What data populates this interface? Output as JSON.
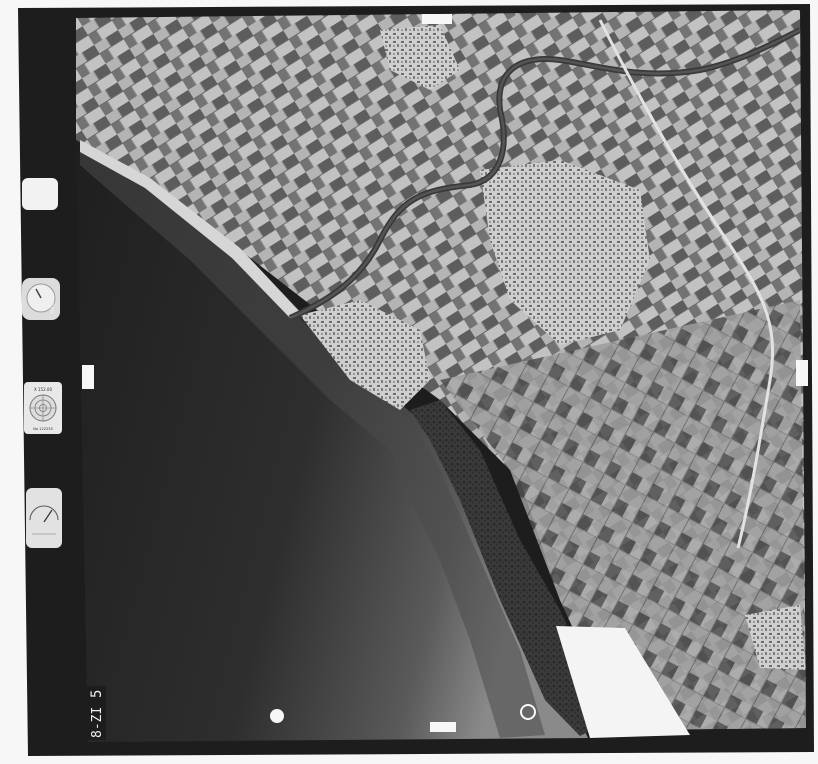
{
  "photo": {
    "frame_number": "5",
    "strip_code": "8-ZI",
    "instrument_labels": {
      "altimeter_top": "X 152.00",
      "altimeter_bottom": "No 122235",
      "clock_label": "KERN"
    }
  },
  "colors": {
    "film_border": "#1d1d1d",
    "sea_dark": "#242424",
    "sea_light": "#6a6a6a",
    "land_mid": "#9a9a9a",
    "town_light": "#d0d0d0",
    "paper": "#f7f7f7"
  }
}
